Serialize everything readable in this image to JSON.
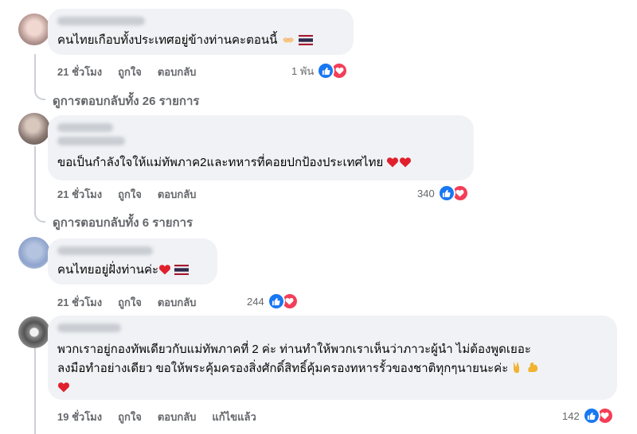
{
  "comments": [
    {
      "text": "คนไทยเกือบทั้งประเทศอยู่ข้างท่านคะตอนนี้",
      "time": "21 ชั่วโมง",
      "like": "ถูกใจ",
      "reply": "ตอบกลับ",
      "reaction_count": "1 พัน",
      "emoji": [
        "handshake-heart-icon",
        "thai-flag-icon"
      ]
    },
    {
      "text": "ขอเป็นกำลังใจให้แม่ทัพภาค2และทหารที่คอยปกป้องประเทศไทย",
      "time": "21 ชั่วโมง",
      "like": "ถูกใจ",
      "reply": "ตอบกลับ",
      "reaction_count": "340",
      "emoji": [
        "red-heart-icon",
        "red-heart-icon"
      ]
    },
    {
      "text": "คนไทยอยู่ฝั่งท่านค่ะ",
      "time": "21 ชั่วโมง",
      "like": "ถูกใจ",
      "reply": "ตอบกลับ",
      "reaction_count": "244",
      "emoji": [
        "red-heart-icon",
        "thai-flag-icon"
      ]
    },
    {
      "text_line1": "พวกเราอยู่กองทัพเดียวกับแม่ทัพภาคที่ 2 ค่ะ ท่านทำให้พวกเราเห็นว่าภาวะผู้นำ ไม่ต้องพูดเยอะ",
      "text_line2": "ลงมือทำอย่างเดียว ขอให้พระคุ้มครองสิ่งศักดิ์สิทธิ์คุ้มครองทหารรั้วของชาติทุกๆนายนะค่ะ",
      "time": "19 ชั่วโมง",
      "like": "ถูกใจ",
      "reply": "ตอบกลับ",
      "edited": "แก้ไขแล้ว",
      "reaction_count": "142",
      "emoji": [
        "victory-hand-icon",
        "flexed-biceps-icon",
        "red-heart-icon"
      ]
    }
  ],
  "view_replies": [
    "ดูการตอบกลับทั้ง 26 รายการ",
    "ดูการตอบกลับทั้ง 6 รายการ"
  ],
  "colors": {
    "bubble": "#f0f2f5",
    "meta": "#65676b",
    "like": "#1877f2",
    "love": "#f33e58"
  }
}
